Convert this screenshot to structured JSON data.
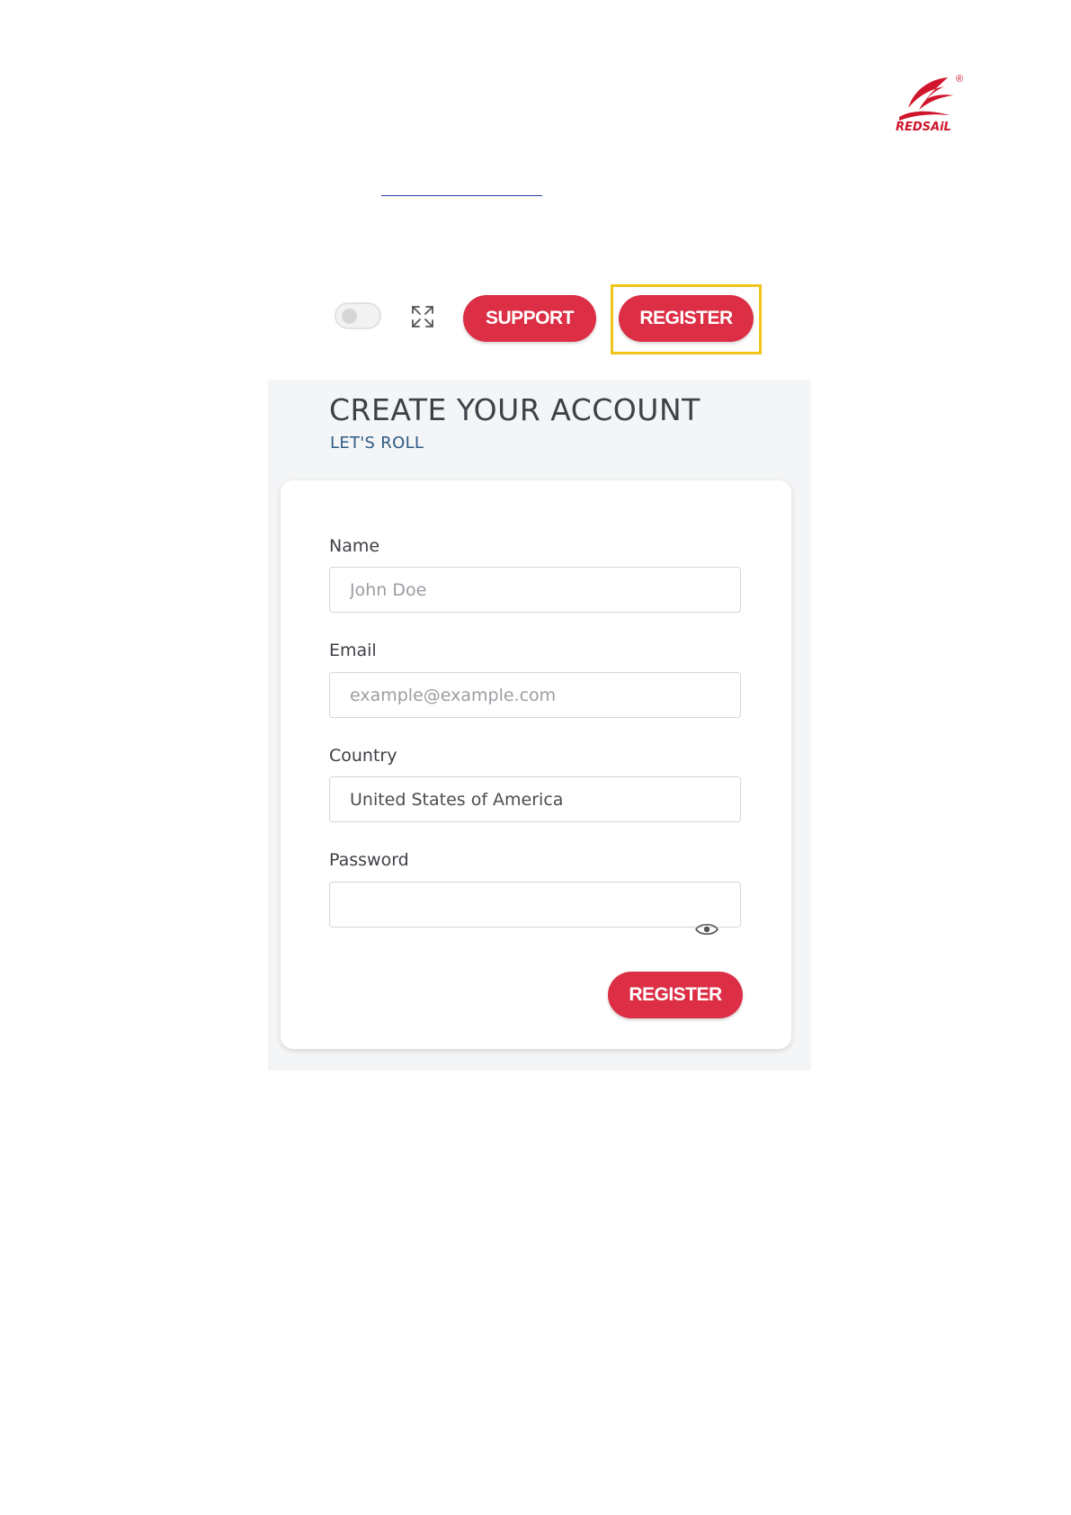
{
  "brand": {
    "wordmark": "REDSAiL",
    "registered_mark": "®",
    "color": "#d0152b"
  },
  "toolbar": {
    "theme_toggle_on": false,
    "support_label": "SUPPORT",
    "register_label": "REGISTER",
    "accent_color": "#dc2f45",
    "highlight_color": "#f0c419"
  },
  "form": {
    "title": "CREATE YOUR ACCOUNT",
    "subtitle": "LET'S ROLL",
    "name_label": "Name",
    "name_placeholder": "John Doe",
    "email_label": "Email",
    "email_placeholder": "example@example.com",
    "country_label": "Country",
    "country_value": "United States of America",
    "password_label": "Password",
    "password_value": "",
    "submit_label": "REGISTER"
  }
}
